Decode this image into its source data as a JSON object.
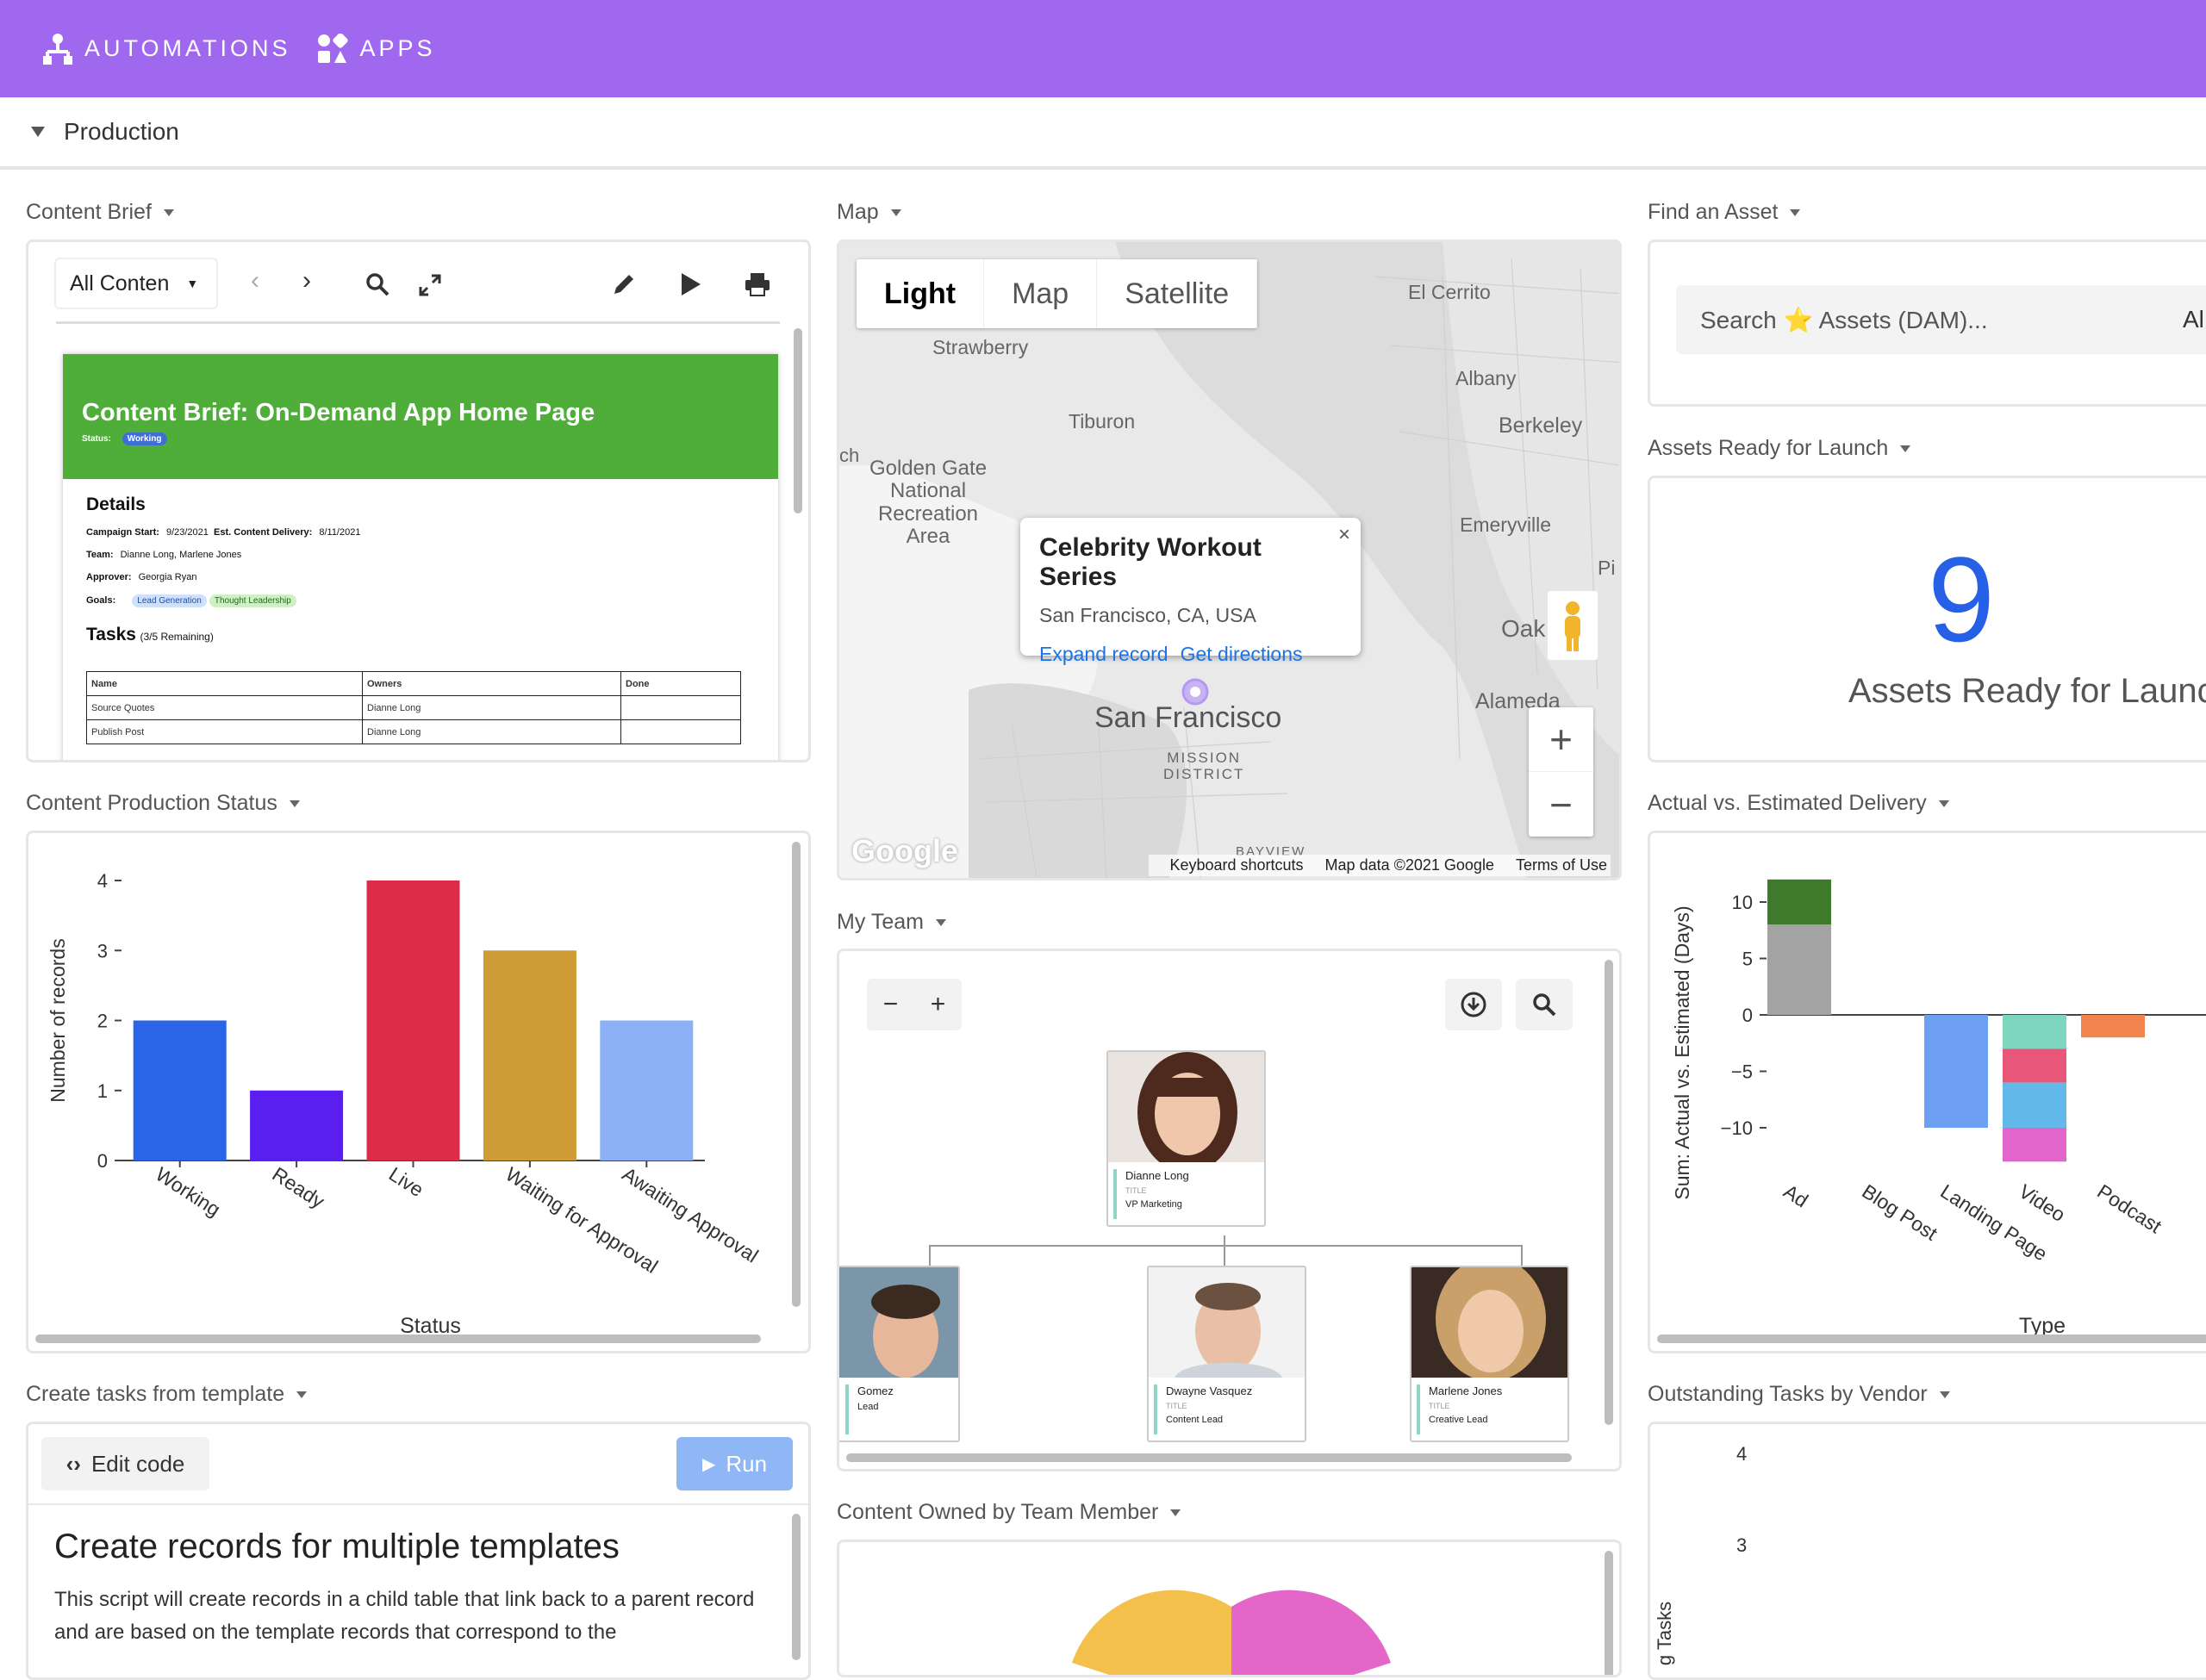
{
  "topbar": {
    "automations_label": "AUTOMATIONS",
    "apps_label": "APPS",
    "color": "#9f68ef"
  },
  "section": {
    "title": "Production"
  },
  "content_brief": {
    "title": "Content Brief",
    "view_select": "All Conten",
    "doc": {
      "heading": "Content Brief: On-Demand App Home Page",
      "status_label": "Status:",
      "status_value": "Working",
      "details_heading": "Details",
      "campaign_start_label": "Campaign Start:",
      "campaign_start": "9/23/2021",
      "est_delivery_label": "Est. Content Delivery:",
      "est_delivery": "8/11/2021",
      "team_label": "Team:",
      "team": "Dianne Long, Marlene Jones",
      "approver_label": "Approver:",
      "approver": "Georgia Ryan",
      "goals_label": "Goals:",
      "goals": [
        "Lead Generation",
        "Thought Leadership"
      ],
      "tasks_heading": "Tasks",
      "tasks_remaining": "(3/5 Remaining)",
      "table_headers": [
        "Name",
        "Owners",
        "Done"
      ],
      "table_rows": [
        [
          "Source Quotes",
          "Dianne Long",
          ""
        ],
        [
          "Publish Post",
          "Dianne Long",
          ""
        ]
      ]
    }
  },
  "map": {
    "title": "Map",
    "types": [
      "Light",
      "Map",
      "Satellite"
    ],
    "selected_type": "Light",
    "labels": {
      "el_cerrito": "El Cerrito",
      "strawberry": "Strawberry",
      "albany": "Albany",
      "tiburon": "Tiburon",
      "berkeley": "Berkeley",
      "golden_gate": "Golden Gate\nNational\nRecreation\nArea",
      "emeryville": "Emeryville",
      "oak": "Oak",
      "alameda": "Alameda",
      "san_francisco": "San Francisco",
      "mission": "MISSION\nDISTRICT",
      "bayview": "BAYVIEW",
      "pi": "Pi",
      "ch": "ch"
    },
    "popup": {
      "title": "Celebrity Workout Series",
      "subtitle": "San Francisco, CA, USA",
      "link1": "Expand record",
      "link2": "Get directions"
    },
    "google": "Google",
    "footer": [
      "Keyboard shortcuts",
      "Map data ©2021 Google",
      "Terms of Use"
    ]
  },
  "find_asset": {
    "title": "Find an Asset",
    "search_text": "Search ⭐ Assets (DAM)...",
    "trailing": "Al"
  },
  "assets_ready": {
    "title": "Assets Ready for Launch",
    "value": "9",
    "caption": "Assets Ready for Launch"
  },
  "production_status": {
    "title": "Content Production Status",
    "chart_data": {
      "type": "bar",
      "categories": [
        "Working",
        "Ready",
        "Live",
        "Waiting for Approval",
        "Awaiting Approval"
      ],
      "values": [
        2,
        1,
        4,
        3,
        2
      ],
      "colors": [
        "#2a65e8",
        "#5b1ef0",
        "#dc2c47",
        "#cf9b34",
        "#8cb0f5"
      ],
      "xlabel": "Status",
      "ylabel": "Number of records",
      "ylim": [
        0,
        4
      ],
      "yticks": [
        0,
        1,
        2,
        3,
        4
      ]
    }
  },
  "my_team": {
    "title": "My Team",
    "people": [
      {
        "name": "Dianne Long",
        "title_label": "TITLE",
        "role": "VP Marketing"
      },
      {
        "name": "Gomez",
        "title_label": "",
        "role": "Lead"
      },
      {
        "name": "Dwayne Vasquez",
        "title_label": "TITLE",
        "role": "Content Lead"
      },
      {
        "name": "Marlene Jones",
        "title_label": "TITLE",
        "role": "Creative Lead"
      }
    ]
  },
  "delivery": {
    "title": "Actual vs. Estimated Delivery",
    "chart_data": {
      "type": "bar",
      "categories": [
        "Ad",
        "Blog Post",
        "Landing Page",
        "Video",
        "Podcast"
      ],
      "stacks": [
        [
          {
            "value": 8,
            "color": "#a3a3a3"
          },
          {
            "value": 4,
            "color": "#3f7a2c"
          }
        ],
        [],
        [
          {
            "value": -10,
            "color": "#6da0f2"
          }
        ],
        [
          {
            "value": -3,
            "color": "#7dd6bd"
          },
          {
            "value": -3,
            "color": "#e8577a"
          },
          {
            "value": -4,
            "color": "#62b8e8"
          },
          {
            "value": -3,
            "color": "#e265cc"
          }
        ],
        [
          {
            "value": -2,
            "color": "#f2844e"
          }
        ]
      ],
      "xlabel": "Type",
      "ylabel": "Sum: Actual vs. Estimated (Days)",
      "yticks": [
        10,
        5,
        0,
        -5,
        -10
      ],
      "ylim": [
        -13,
        12
      ]
    }
  },
  "create_tasks": {
    "title": "Create tasks from template",
    "edit_label": "Edit code",
    "run_label": "Run",
    "heading": "Create records for multiple templates",
    "body": "This script will create records in a child table that link back to a parent record and are based on the template records that correspond to the"
  },
  "outstanding": {
    "title": "Outstanding Tasks by Vendor",
    "yticks": [
      "4",
      "3"
    ],
    "ylabel": "g Tasks"
  },
  "content_owned": {
    "title": "Content Owned by Team Member"
  }
}
